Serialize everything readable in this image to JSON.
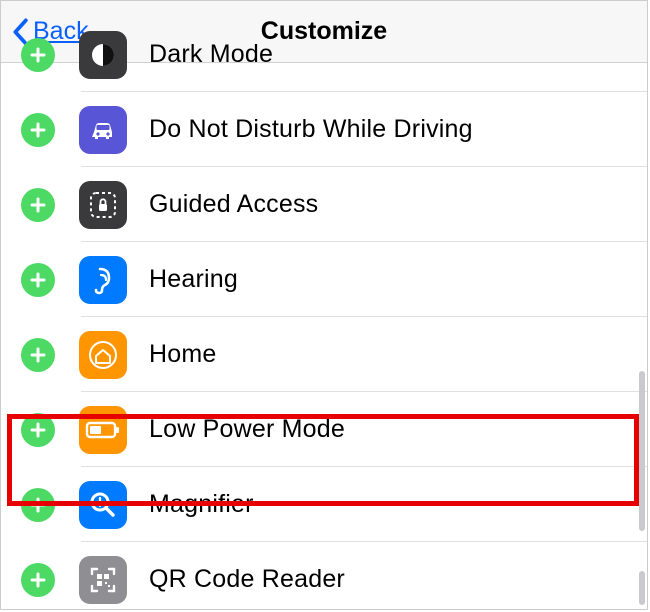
{
  "header": {
    "back_label": "Back",
    "title": "Customize"
  },
  "rows": [
    {
      "label": "Dark Mode"
    },
    {
      "label": "Do Not Disturb While Driving"
    },
    {
      "label": "Guided Access"
    },
    {
      "label": "Hearing"
    },
    {
      "label": "Home"
    },
    {
      "label": "Low Power Mode"
    },
    {
      "label": "Magnifier"
    },
    {
      "label": "QR Code Reader"
    }
  ],
  "colors": {
    "add_green": "#4cd964",
    "blue": "#007aff",
    "orange": "#ff9500",
    "dark": "#3a3a3c",
    "gray": "#8e8e93",
    "highlight": "#e60000"
  }
}
